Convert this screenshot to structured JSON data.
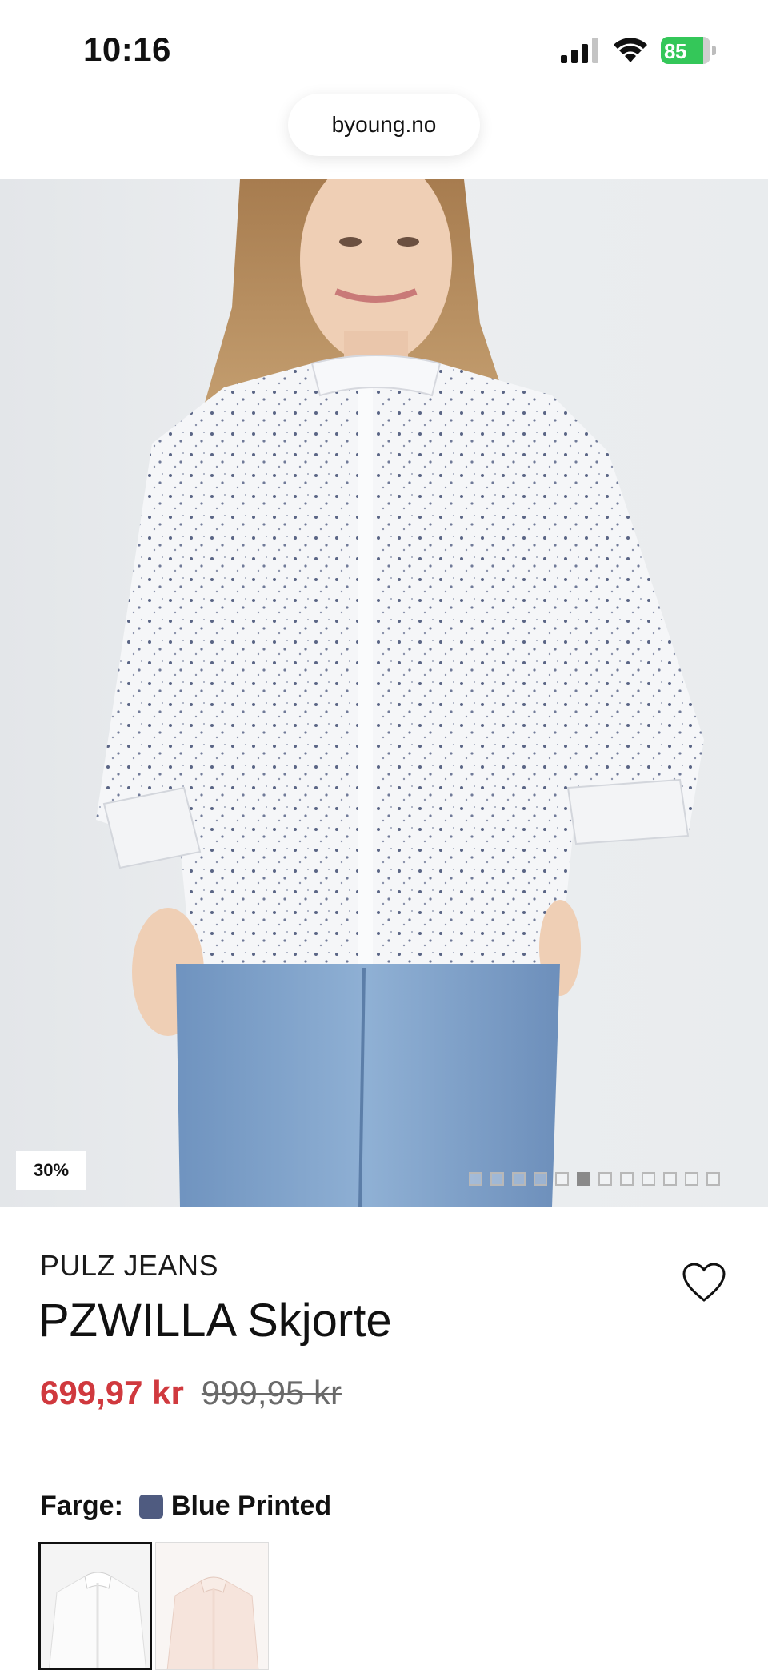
{
  "status_bar": {
    "time": "10:16",
    "battery_level": "85",
    "battery_fraction": 0.85
  },
  "browser": {
    "url": "byoung.no"
  },
  "product_image": {
    "discount_badge": "30%",
    "carousel": {
      "total": 12,
      "active_index": 5
    }
  },
  "product": {
    "brand": "PULZ JEANS",
    "title": "PZWILLA Skjorte",
    "price_sale": "699,97 kr",
    "price_original": "999,95 kr",
    "wishlist_icon": "heart-icon"
  },
  "color": {
    "label": "Farge:",
    "selected_name": "Blue Printed",
    "swatch_hex": "#4f5b80",
    "variants": [
      {
        "name": "Blue Printed",
        "selected": true
      },
      {
        "name": "Pink Printed",
        "selected": false
      }
    ]
  },
  "colors": {
    "sale_price": "#d0393e",
    "accent_battery": "#34c759"
  }
}
